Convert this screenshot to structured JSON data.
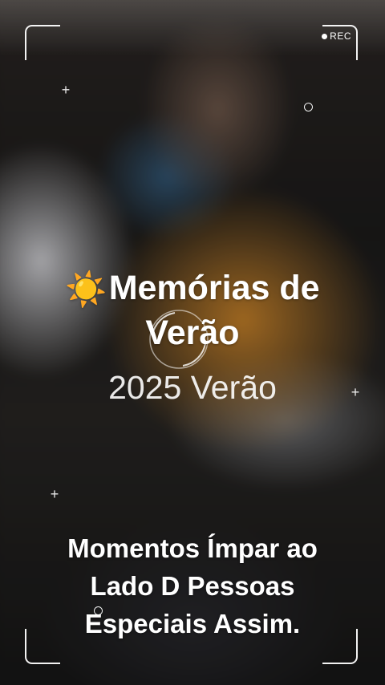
{
  "status": {
    "rec_label": "REC"
  },
  "overlay": {
    "title_emoji": "☀️",
    "title": "Memórias de Verão",
    "subtitle": "2025 Verão",
    "message": "Momentos Ímpar ao Lado D Pessoas Especiais Assim."
  },
  "icons": {
    "rec_dot": "record-dot-icon",
    "crosshair": "plus-icon",
    "focus": "focus-ring-icon",
    "sun": "sun-icon"
  },
  "colors": {
    "text": "#ffffff",
    "accent_orange": "#c8822a"
  }
}
